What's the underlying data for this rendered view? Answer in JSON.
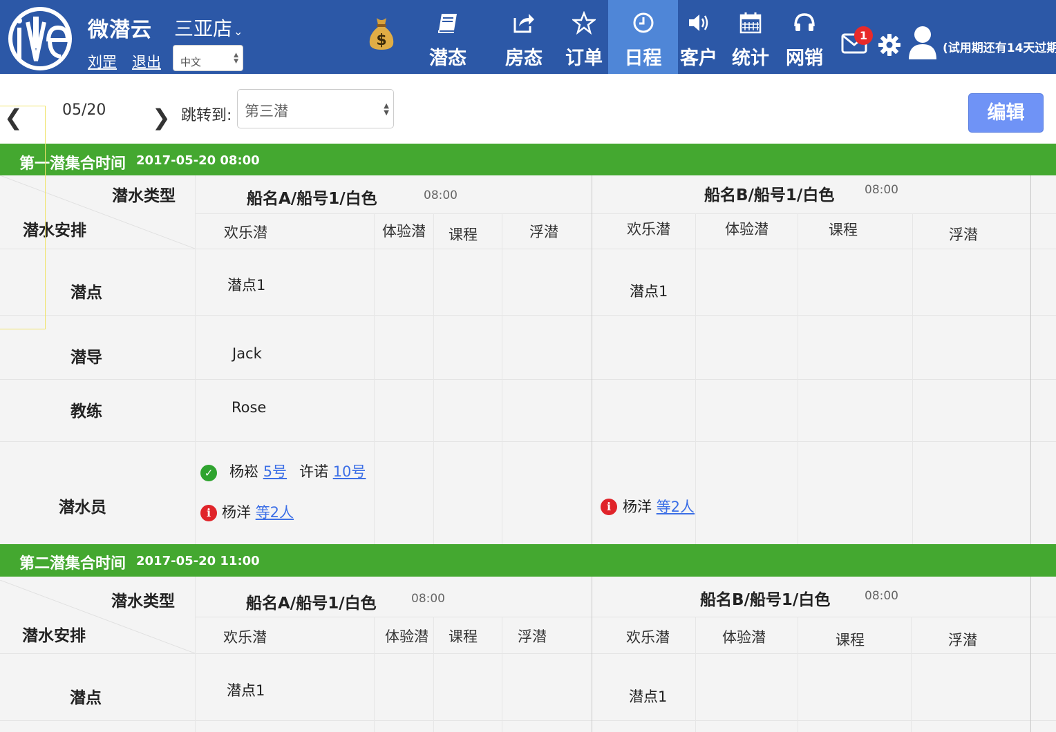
{
  "header": {
    "brand": "微潜云",
    "store": "三亚店",
    "user_name": "刘罡",
    "logout_label": "退出",
    "language": "中文",
    "nav": [
      {
        "label": "潜态",
        "icon": "book-icon"
      },
      {
        "label": "房态",
        "icon": "share-icon"
      },
      {
        "label": "订单",
        "icon": "star-icon"
      },
      {
        "label": "日程",
        "icon": "clock-icon",
        "active": true
      },
      {
        "label": "客户",
        "icon": "speaker-icon"
      },
      {
        "label": "统计",
        "icon": "calendar-icon"
      },
      {
        "label": "网销",
        "icon": "headset-icon"
      }
    ],
    "unread_count": "1",
    "trial_notice": "(试用期还有14天过期)"
  },
  "datebar": {
    "date": "05/20",
    "jump_label": "跳转到:",
    "jump_value": "第三潜",
    "edit_label": "编辑"
  },
  "column_types": [
    "欢乐潜",
    "体验潜",
    "课程",
    "浮潜"
  ],
  "row_labels": {
    "dive_type": "潜水类型",
    "arrangement": "潜水安排",
    "site": "潜点",
    "guide": "潜导",
    "coach": "教练",
    "divers": "潜水员"
  },
  "groups": [
    {
      "title": "第一潜集合时间",
      "time": "2017-05-20 08:00",
      "boats": [
        {
          "name": "船名A/船号1/白色",
          "time": "08:00",
          "site": "潜点1",
          "guide": "Jack",
          "coach": "Rose",
          "divers_confirmed": [
            {
              "name": "杨崧",
              "num": "5号"
            },
            {
              "name": "许诺",
              "num": "10号"
            }
          ],
          "divers_pending": {
            "name": "杨洋",
            "more": "等2人"
          }
        },
        {
          "name": "船名B/船号1/白色",
          "time": "08:00",
          "site": "潜点1",
          "divers_pending": {
            "name": "杨洋",
            "more": "等2人"
          }
        }
      ]
    },
    {
      "title": "第二潜集合时间",
      "time": "2017-05-20 11:00",
      "boats": [
        {
          "name": "船名A/船号1/白色",
          "time": "08:00",
          "site": "潜点1"
        },
        {
          "name": "船名B/船号1/白色",
          "time": "08:00",
          "site": "潜点1"
        }
      ]
    }
  ],
  "colors": {
    "nav_bg": "#2c58a7",
    "nav_active": "#4f86d7",
    "group_header": "#44a830",
    "edit_button": "#6f93f6",
    "link": "#3c6fe6",
    "badge": "#e82a2a"
  }
}
